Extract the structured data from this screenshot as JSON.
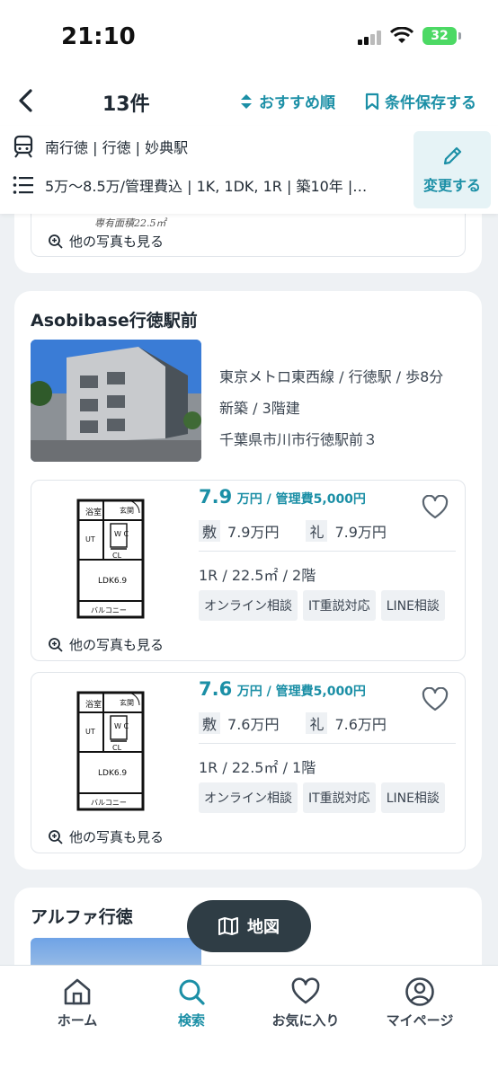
{
  "status_bar": {
    "time": "21:10",
    "battery": "32"
  },
  "header": {
    "result_count": "13件",
    "sort_label": "おすすめ順",
    "save_label": "条件保存する"
  },
  "conditions": {
    "stations": "南行徳 | 行徳 | 妙典駅",
    "filters": "5万〜8.5万/管理費込 | 1K, 1DK, 1R | 築10年 |…",
    "change_label": "変更する"
  },
  "previous_card": {
    "caption": "専有面積22.5㎡",
    "more_photos": "他の写真も見る"
  },
  "property": {
    "name": "Asobibase行徳駅前",
    "access": "東京メトロ東西線 / 行徳駅 / 歩8分",
    "building": "新築 / 3階建",
    "address": "千葉県市川市行徳駅前３",
    "units": [
      {
        "price": "7.9",
        "price_suffix": "万円 / 管理費5,000円",
        "deposit_label": "敷",
        "deposit": "7.9万円",
        "key_money_label": "礼",
        "key_money": "7.9万円",
        "spec": "1R / 22.5㎡ / 2階",
        "tags": [
          "オンライン相談",
          "IT重説対応",
          "LINE相談"
        ],
        "more_photos": "他の写真も見る",
        "plan": {
          "bath": "浴室",
          "entrance": "玄関",
          "wc": "W C",
          "ut": "UT",
          "cl": "CL",
          "ldk": "LDK6.9",
          "balcony": "バルコニー"
        }
      },
      {
        "price": "7.6",
        "price_suffix": "万円 / 管理費5,000円",
        "deposit_label": "敷",
        "deposit": "7.6万円",
        "key_money_label": "礼",
        "key_money": "7.6万円",
        "spec": "1R / 22.5㎡ / 1階",
        "tags": [
          "オンライン相談",
          "IT重説対応",
          "LINE相談"
        ],
        "more_photos": "他の写真も見る",
        "plan": {
          "bath": "浴室",
          "entrance": "玄関",
          "wc": "W C",
          "ut": "UT",
          "cl": "CL",
          "ldk": "LDK6.9",
          "balcony": "バルコニー"
        }
      }
    ]
  },
  "next_property": {
    "name": "アルファ行徳"
  },
  "map_button": {
    "label": "地図"
  },
  "bottom_nav": {
    "items": [
      {
        "label": "ホーム",
        "icon": "home-icon"
      },
      {
        "label": "検索",
        "icon": "search-icon"
      },
      {
        "label": "お気に入り",
        "icon": "heart-icon"
      },
      {
        "label": "マイページ",
        "icon": "user-icon"
      }
    ]
  },
  "colors": {
    "accent": "#1b8fa6",
    "map_button_bg": "#2f3d45",
    "page_bg": "#eef1f4"
  }
}
